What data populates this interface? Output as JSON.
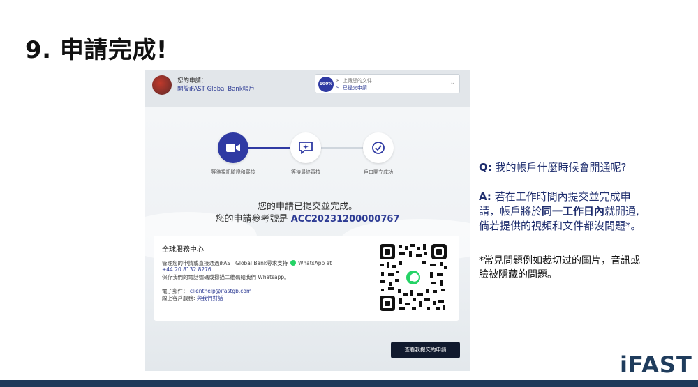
{
  "slide": {
    "title": "9. 申請完成!"
  },
  "header": {
    "label": "您的申請：",
    "link": "開設iFAST Global Bank帳戶",
    "progress": {
      "percent": "100%",
      "prev_step": "8. 上傳您的文件",
      "current_step": "9. 已提交申請"
    }
  },
  "steps": [
    {
      "label": "等待視訊驗證和審核",
      "icon": "video-camera-icon",
      "status": "active"
    },
    {
      "label": "等待最終審核",
      "icon": "chat-sparkle-icon",
      "status": "pending"
    },
    {
      "label": "戶口開立成功",
      "icon": "check-circle-icon",
      "status": "pending"
    }
  ],
  "message": {
    "line1": "您的申請已提交並完成。",
    "line2_prefix": "您的申請參考號是",
    "reference": "ACC20231200000767"
  },
  "service": {
    "title": "全球服務中心",
    "line1": "管理您的申請或直接通過iFAST Global Bank尋求支持",
    "whatsapp": "WhatsApp at",
    "phone": "+44 20 8132 8276",
    "line3": "保存我們的電話號碼或掃描二維碼給我們 Whatsapp。",
    "email_label": "電子郵件：",
    "email": "clienthelp@ifastgb.com",
    "online_label": "線上客戶服務:",
    "online_link": "與我們對話"
  },
  "buttons": {
    "view_application": "查看我提交的申請"
  },
  "qa": {
    "q_label": "Q:",
    "question": "我的帳戶什麼時候會開通呢?",
    "a_label": "A:",
    "answer_l1": "若在工作時間內提交並完成申",
    "answer_l2_pre": "請，帳戶將於",
    "answer_l2_bold": "同一工作日內",
    "answer_l2_post": "就開通,",
    "answer_l3": "倘若提供的視頻和文件都沒問題*。"
  },
  "note": {
    "line1": "*常見問題例如裁切过的圖片，音訊或",
    "line2": "臉被隱藏的問題。"
  },
  "brand": {
    "logo": "iFAST",
    "accent": "#2f3aa3",
    "bar": "#1f3a5a"
  }
}
